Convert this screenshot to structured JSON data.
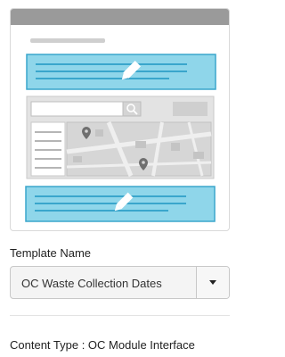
{
  "template": {
    "label": "Template Name",
    "selected": "OC Waste Collection Dates"
  },
  "content_type": {
    "text": "Content Type : OC Module Interface"
  },
  "icons": {
    "edit": "pencil-icon",
    "search": "search-icon",
    "map_pin": "map-pin-icon",
    "dropdown": "caret-down-icon"
  },
  "colors": {
    "highlight_fill": "#8fd6ea",
    "highlight_border": "#3aa6cc",
    "header_bar": "#9a9a9a"
  }
}
